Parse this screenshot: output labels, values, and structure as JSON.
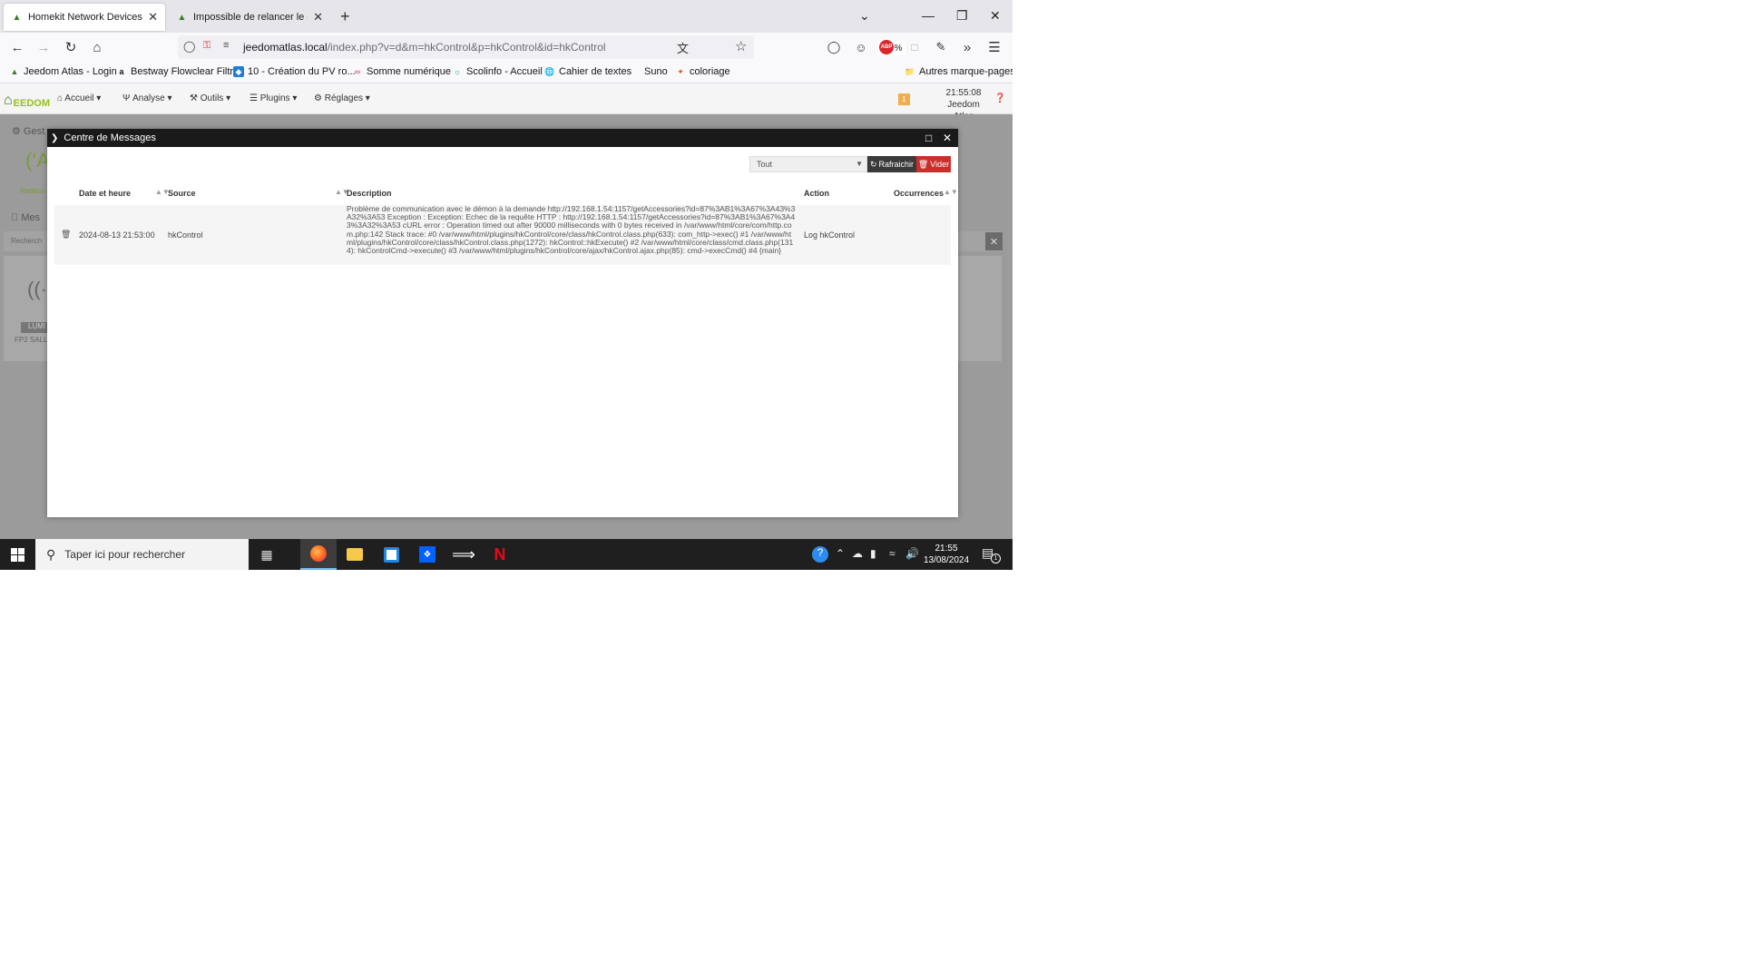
{
  "browser": {
    "tabs": [
      {
        "title": "Homekit Network Devices Cont",
        "active": true
      },
      {
        "title": "Impossible de relancer le démo",
        "active": false
      }
    ],
    "url_host": "jeedomatlas.local",
    "url_path": "/index.php?v=d&m=hkControl&p=hkControl&id=hkControl",
    "zoom": "80 %",
    "bookmarks": [
      "Jeedom Atlas - Login",
      "Bestway Flowclear Filtr...",
      "10 - Création du PV ro...",
      "Somme numérique",
      "Scolinfo - Accueil",
      "Cahier de textes",
      "Suno",
      "coloriage"
    ],
    "other_bookmarks": "Autres marque-pages",
    "abp_badge": "ABP"
  },
  "jeedom": {
    "logo_text": "EEDOM",
    "menu": [
      "Accueil",
      "Analyse",
      "Outils",
      "Plugins",
      "Réglages"
    ],
    "badge_count": "1",
    "time": "21:55:08",
    "instance_name": "Jeedom Atlas",
    "help": "?"
  },
  "background_page": {
    "title_fragment": "Gest",
    "mes_fragment": "Mes",
    "recherche_fragment": "Recherch",
    "redecouv_fragment": "Redéco",
    "card_label": "LUMI",
    "card_sub": "FP2 SALL"
  },
  "modal": {
    "title": "Centre de Messages",
    "filter_value": "Tout",
    "refresh_label": "Rafraichir",
    "clear_label": "Vider",
    "columns": [
      "Date et heure",
      "Source",
      "Description",
      "Action",
      "Occurrences"
    ],
    "rows": [
      {
        "date": "2024-08-13 21:53:00",
        "source": "hkControl",
        "description": "Problème de communication avec le démon à la demande http://192.168.1.54:1157/getAccessories?id=87%3AB1%3A67%3A43%3A32%3A53 Exception : Exception: Echec de la requête HTTP : http://192.168.1.54:1157/getAccessories?id=87%3AB1%3A67%3A43%3A32%3A53 cURL error : Operation timed out after 90000 milliseconds with 0 bytes received in /var/www/html/core/com/http.com.php:142 Stack trace: #0 /var/www/html/plugins/hkControl/core/class/hkControl.class.php(633): com_http->exec() #1 /var/www/html/plugins/hkControl/core/class/hkControl.class.php(1272): hkControl::hkExecute() #2 /var/www/html/core/class/cmd.class.php(1314): hkControlCmd->execute() #3 /var/www/html/plugins/hkControl/core/ajax/hkControl.ajax.php(85): cmd->execCmd() #4 {main}",
        "action": "Log hkControl",
        "occurrences": ""
      }
    ]
  },
  "taskbar": {
    "search_placeholder": "Taper ici pour rechercher",
    "clock_time": "21:55",
    "clock_date": "13/08/2024",
    "notification_count": "1"
  }
}
